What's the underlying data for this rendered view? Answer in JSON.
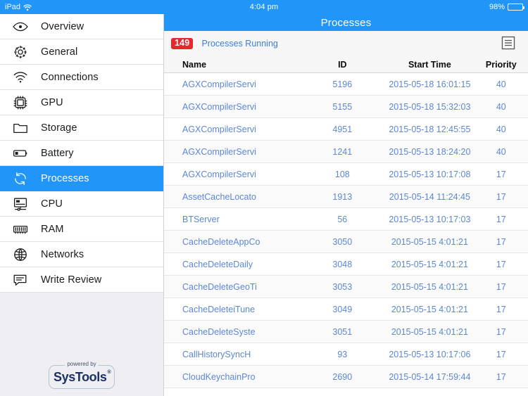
{
  "status_bar": {
    "device": "iPad",
    "wifi_icon": "wifi-icon",
    "time": "4:04 pm",
    "battery_percent": "98%",
    "battery_icon": "battery-icon"
  },
  "navbar": {
    "title": "Processes"
  },
  "sidebar": {
    "items": [
      {
        "label": "Overview",
        "icon": "eye-icon",
        "active": false
      },
      {
        "label": "General",
        "icon": "gear-icon",
        "active": false
      },
      {
        "label": "Connections",
        "icon": "wifi-icon",
        "active": false
      },
      {
        "label": "GPU",
        "icon": "chip-icon",
        "active": false
      },
      {
        "label": "Storage",
        "icon": "folder-icon",
        "active": false
      },
      {
        "label": "Battery",
        "icon": "battery-icon",
        "active": false
      },
      {
        "label": "Processes",
        "icon": "refresh-icon",
        "active": true
      },
      {
        "label": "CPU",
        "icon": "monitor-icon",
        "active": false
      },
      {
        "label": "RAM",
        "icon": "memory-icon",
        "active": false
      },
      {
        "label": "Networks",
        "icon": "globe-icon",
        "active": false
      },
      {
        "label": "Write Review",
        "icon": "comment-icon",
        "active": false
      }
    ],
    "footer_logo": {
      "powered_by": "powered by",
      "brand": "SysTools",
      "registered_mark": "®"
    }
  },
  "main": {
    "process_count_badge": "149",
    "process_count_label": "Processes Running",
    "list_icon": "list-icon",
    "columns": [
      "Name",
      "ID",
      "Start Time",
      "Priority"
    ],
    "rows": [
      {
        "name": "AGXCompilerServi",
        "id": "5196",
        "start_time": "2015-05-18 16:01:15",
        "priority": "40"
      },
      {
        "name": "AGXCompilerServi",
        "id": "5155",
        "start_time": "2015-05-18 15:32:03",
        "priority": "40"
      },
      {
        "name": "AGXCompilerServi",
        "id": "4951",
        "start_time": "2015-05-18 12:45:55",
        "priority": "40"
      },
      {
        "name": "AGXCompilerServi",
        "id": "1241",
        "start_time": "2015-05-13 18:24:20",
        "priority": "40"
      },
      {
        "name": "AGXCompilerServi",
        "id": "108",
        "start_time": "2015-05-13 10:17:08",
        "priority": "17"
      },
      {
        "name": "AssetCacheLocato",
        "id": "1913",
        "start_time": "2015-05-14 11:24:45",
        "priority": "17"
      },
      {
        "name": "BTServer",
        "id": "56",
        "start_time": "2015-05-13 10:17:03",
        "priority": "17"
      },
      {
        "name": "CacheDeleteAppCo",
        "id": "3050",
        "start_time": "2015-05-15 4:01:21",
        "priority": "17"
      },
      {
        "name": "CacheDeleteDaily",
        "id": "3048",
        "start_time": "2015-05-15 4:01:21",
        "priority": "17"
      },
      {
        "name": "CacheDeleteGeoTi",
        "id": "3053",
        "start_time": "2015-05-15 4:01:21",
        "priority": "17"
      },
      {
        "name": "CacheDeleteiTune",
        "id": "3049",
        "start_time": "2015-05-15 4:01:21",
        "priority": "17"
      },
      {
        "name": "CacheDeleteSyste",
        "id": "3051",
        "start_time": "2015-05-15 4:01:21",
        "priority": "17"
      },
      {
        "name": "CallHistorySyncH",
        "id": "93",
        "start_time": "2015-05-13 10:17:06",
        "priority": "17"
      },
      {
        "name": "CloudKeychainPro",
        "id": "2690",
        "start_time": "2015-05-14 17:59:44",
        "priority": "17"
      }
    ]
  },
  "colors": {
    "accent_blue": "#2196f8",
    "badge_red": "#e8262d",
    "row_text_blue": "#5b87d4",
    "link_blue": "#3d7fd0",
    "sidebar_footer": "#eeeef3"
  }
}
